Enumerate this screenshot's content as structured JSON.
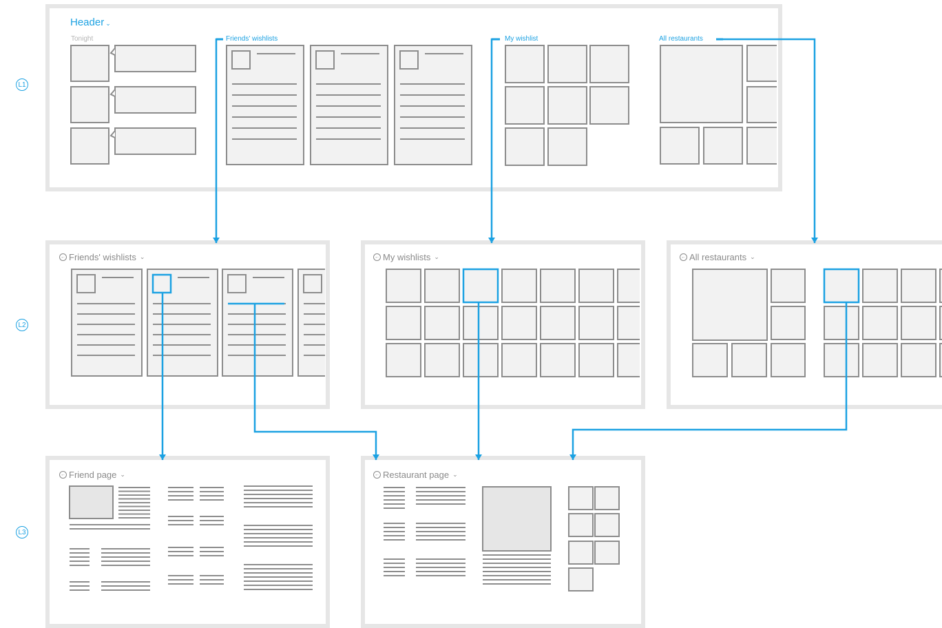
{
  "levels": [
    "L1",
    "L2",
    "L3"
  ],
  "l1": {
    "header": "Header",
    "sections": [
      "Tonight",
      "Friends' wishlists",
      "My wishlist",
      "All restaurants"
    ]
  },
  "l2": {
    "friends": "Friends' wishlists",
    "mywishlists": "My wishlists",
    "allrestaurants": "All restaurants"
  },
  "l3": {
    "friend": "Friend page",
    "restaurant": "Restaurant page"
  },
  "colors": {
    "accent": "#1ba1e2",
    "panel_border": "#e6e6e6",
    "tile_fill": "#f2f2f2",
    "tile_border": "#8c8c8c",
    "line": "#8c8c8c"
  },
  "icons": {
    "back": "back-arrow-icon",
    "dropdown": "chevron-down-icon"
  }
}
